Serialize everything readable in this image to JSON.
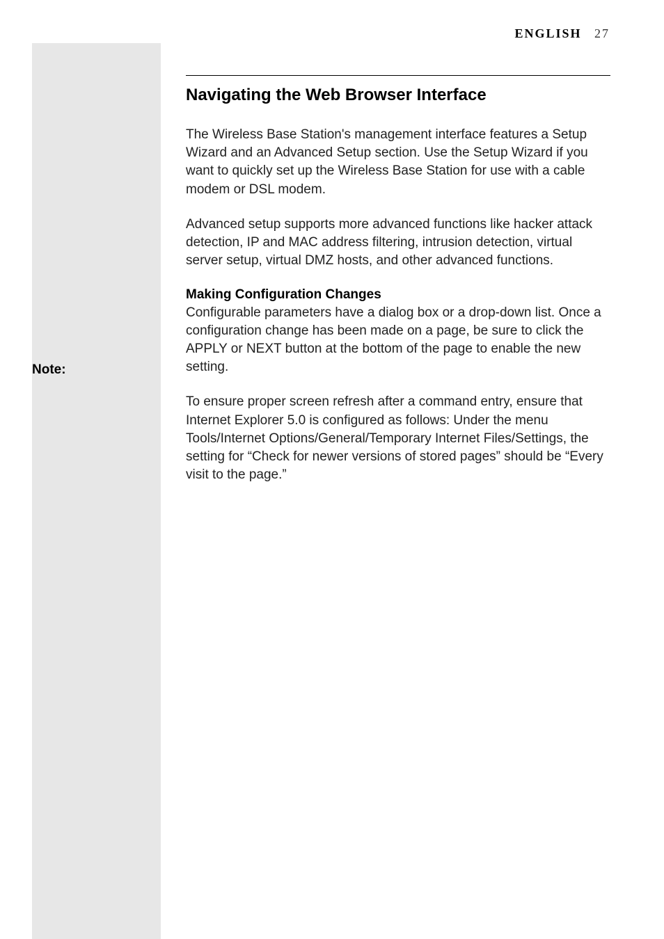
{
  "header": {
    "language": "ENGLISH",
    "page_number": "27"
  },
  "sidebar": {
    "note_label": "Note:"
  },
  "content": {
    "section_title": "Navigating the Web Browser Interface",
    "paragraph_1": "The Wireless Base Station's management interface features a Setup Wizard and an Advanced Setup section. Use the Setup Wizard if you want to quickly set up the Wireless Base Station for use with a cable modem or DSL modem.",
    "paragraph_2": "Advanced setup supports more advanced functions like hacker attack detection, IP and MAC address filtering, intrusion detection, virtual server setup, virtual DMZ hosts, and other advanced functions.",
    "sub_heading": "Making Configuration Changes",
    "paragraph_3": "Configurable parameters have a dialog box or a drop-down list. Once a configuration change has been made on a page, be sure to click the APPLY or NEXT button at the bottom of the page to enable the new setting.",
    "paragraph_4": "To ensure proper screen refresh after a command entry, ensure that Internet Explorer 5.0 is configured as follows: Under the menu Tools/Internet Options/General/Temporary Internet Files/Settings, the setting for “Check for newer versions of stored pages” should be “Every visit to the page.”"
  }
}
